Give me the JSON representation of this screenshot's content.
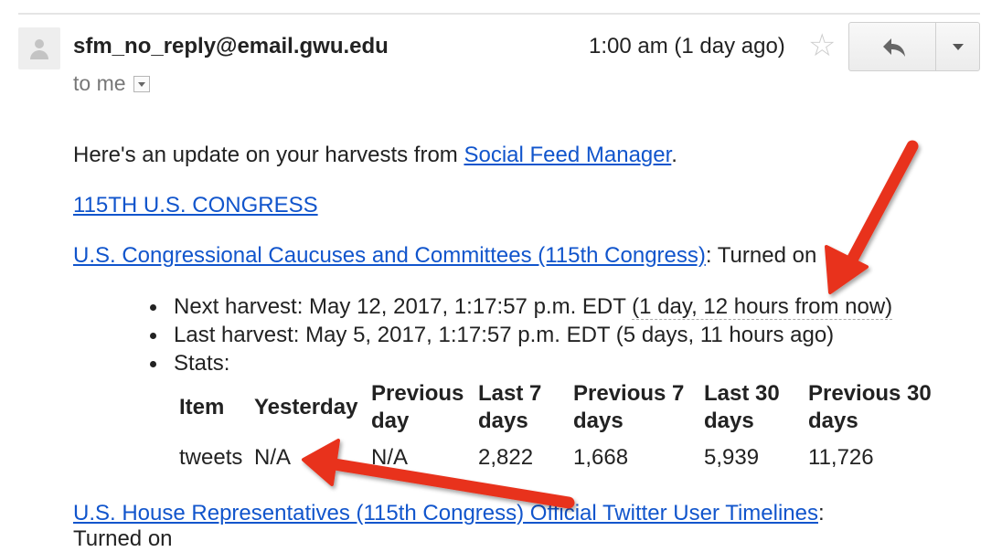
{
  "header": {
    "sender": "sfm_no_reply@email.gwu.edu",
    "to_label": "to me",
    "time": "1:00 am (1 day ago)",
    "icons": [
      "avatar-icon",
      "star-icon",
      "reply-icon",
      "more-caret-icon",
      "to-details-dropdown-icon"
    ]
  },
  "body": {
    "intro_prefix": "Here's an update on your harvests from ",
    "intro_link": "Social Feed Manager",
    "intro_suffix": ".",
    "collection_set_link": "115TH U.S. CONGRESS",
    "collection1": {
      "link": "U.S. Congressional Caucuses and Committees (115th Congress)",
      "status": ": Turned on"
    },
    "bullets": {
      "next_prefix": "Next harvest: May 12, 2017, 1:17:57 p.m. EDT ",
      "next_relative": "(1 day, 12 hours from now)",
      "last": "Last harvest: May 5, 2017, 1:17:57 p.m. EDT (5 days, 11 hours ago)",
      "stats": "Stats:"
    },
    "stats_table": {
      "headers": [
        "Item",
        "Yesterday",
        "Previous day",
        "Last 7 days",
        "Previous 7 days",
        "Last 30 days",
        "Previous 30 days"
      ],
      "header_lines": [
        [
          "Item"
        ],
        [
          "Yesterday"
        ],
        [
          "Previous",
          "day"
        ],
        [
          "Last 7",
          "days"
        ],
        [
          "Previous 7",
          "days"
        ],
        [
          "Last 30",
          "days"
        ],
        [
          "Previous 30",
          "days"
        ]
      ],
      "rows": [
        [
          "tweets",
          "N/A",
          "N/A",
          "2,822",
          "1,668",
          "5,939",
          "11,726"
        ]
      ]
    },
    "collection2": {
      "link": "U.S. House Representatives (115th Congress) Official Twitter User Timelines",
      "status": ":"
    },
    "cut_off_text": "Turned on"
  },
  "annotations": {
    "arrow_color": "#e8321f"
  },
  "colors": {
    "link": "#1155cc",
    "text": "#222222",
    "muted": "#777777"
  }
}
